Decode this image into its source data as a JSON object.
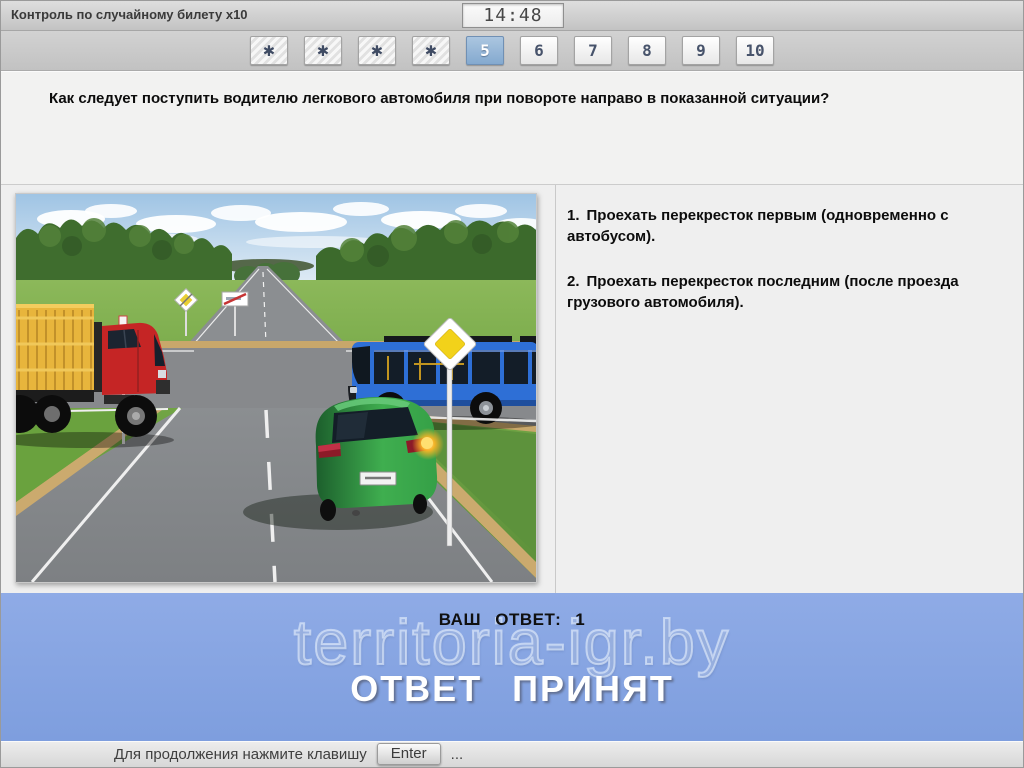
{
  "window": {
    "title": "Контроль по случайному билету x10",
    "timer": "14:48"
  },
  "tabs": {
    "items": [
      {
        "label": "✱",
        "state": "answered"
      },
      {
        "label": "✱",
        "state": "answered"
      },
      {
        "label": "✱",
        "state": "answered"
      },
      {
        "label": "✱",
        "state": "answered"
      },
      {
        "label": "5",
        "state": "active"
      },
      {
        "label": "6",
        "state": "normal"
      },
      {
        "label": "7",
        "state": "normal"
      },
      {
        "label": "8",
        "state": "normal"
      },
      {
        "label": "9",
        "state": "normal"
      },
      {
        "label": "10",
        "state": "normal"
      }
    ]
  },
  "question": {
    "text": "Как следует поступить водителю легкового автомобиля при повороте направо в показанной ситуации?"
  },
  "answers": [
    {
      "number": "1.",
      "text": "Проехать перекресток первым (одновременно с автобусом)."
    },
    {
      "number": "2.",
      "text": "Проехать перекресток последним (после проезда грузового автомобиля)."
    }
  ],
  "result_panel": {
    "your_answer_label": "ВАШ ОТВЕТ:",
    "your_answer_value": "1",
    "status_text": "ОТВЕТ ПРИНЯТ",
    "watermark": "territoria-igr.by"
  },
  "footer": {
    "prompt": "Для продолжения нажмите клавишу",
    "key_label": "Enter",
    "ellipsis": "..."
  },
  "scene": {
    "description": "Перекресток: красный грузовой автомобиль слева, синий автобус справа, зеленый легковой автомобиль с включенным правым указателем поворота, знак Главная дорога",
    "colors": {
      "truck_cab": "#c52525",
      "truck_cargo": "#e8b53c",
      "bus_body": "#2e6fd6",
      "car_body_mid": "#3fae4f",
      "priority_sign_center": "#f2d21a",
      "blinker_core": "#ffdf70",
      "road": "#8a8d90",
      "grass": "#74a746",
      "panel_blue": "#86a5e3"
    }
  }
}
